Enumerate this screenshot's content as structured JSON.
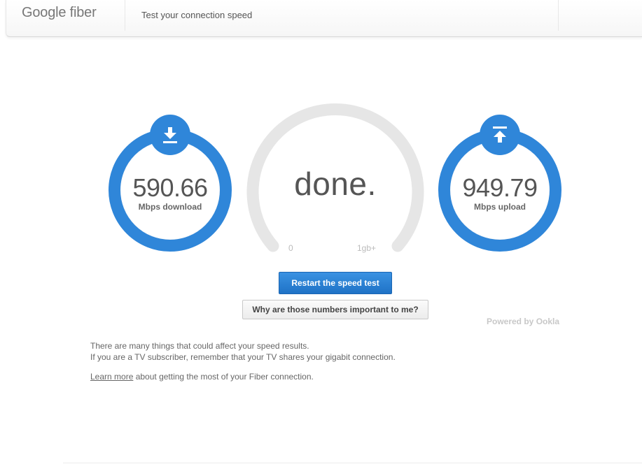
{
  "header": {
    "logo_text": "Google fiber",
    "title": "Test your connection speed"
  },
  "download": {
    "value": "590.66",
    "unit_label": "Mbps download",
    "icon": "download-arrow-icon"
  },
  "upload": {
    "value": "949.79",
    "unit_label": "Mbps upload",
    "icon": "upload-arrow-icon"
  },
  "gauge": {
    "status": "done.",
    "min_label": "0",
    "max_label": "1gb+"
  },
  "actions": {
    "restart_label": "Restart the speed test",
    "why_label": "Why are those numbers important to me?"
  },
  "powered_by": "Powered by Ookla",
  "info": {
    "line1": "There are many things that could affect your speed results.",
    "line2": "If you are a TV subscriber, remember that your TV shares your gigabit connection.",
    "learn_more_link": "Learn more",
    "learn_more_rest": " about getting the most of your Fiber connection."
  },
  "colors": {
    "accent": "#2f86d9",
    "gauge_track": "#e6e6e6",
    "text": "#555555"
  }
}
